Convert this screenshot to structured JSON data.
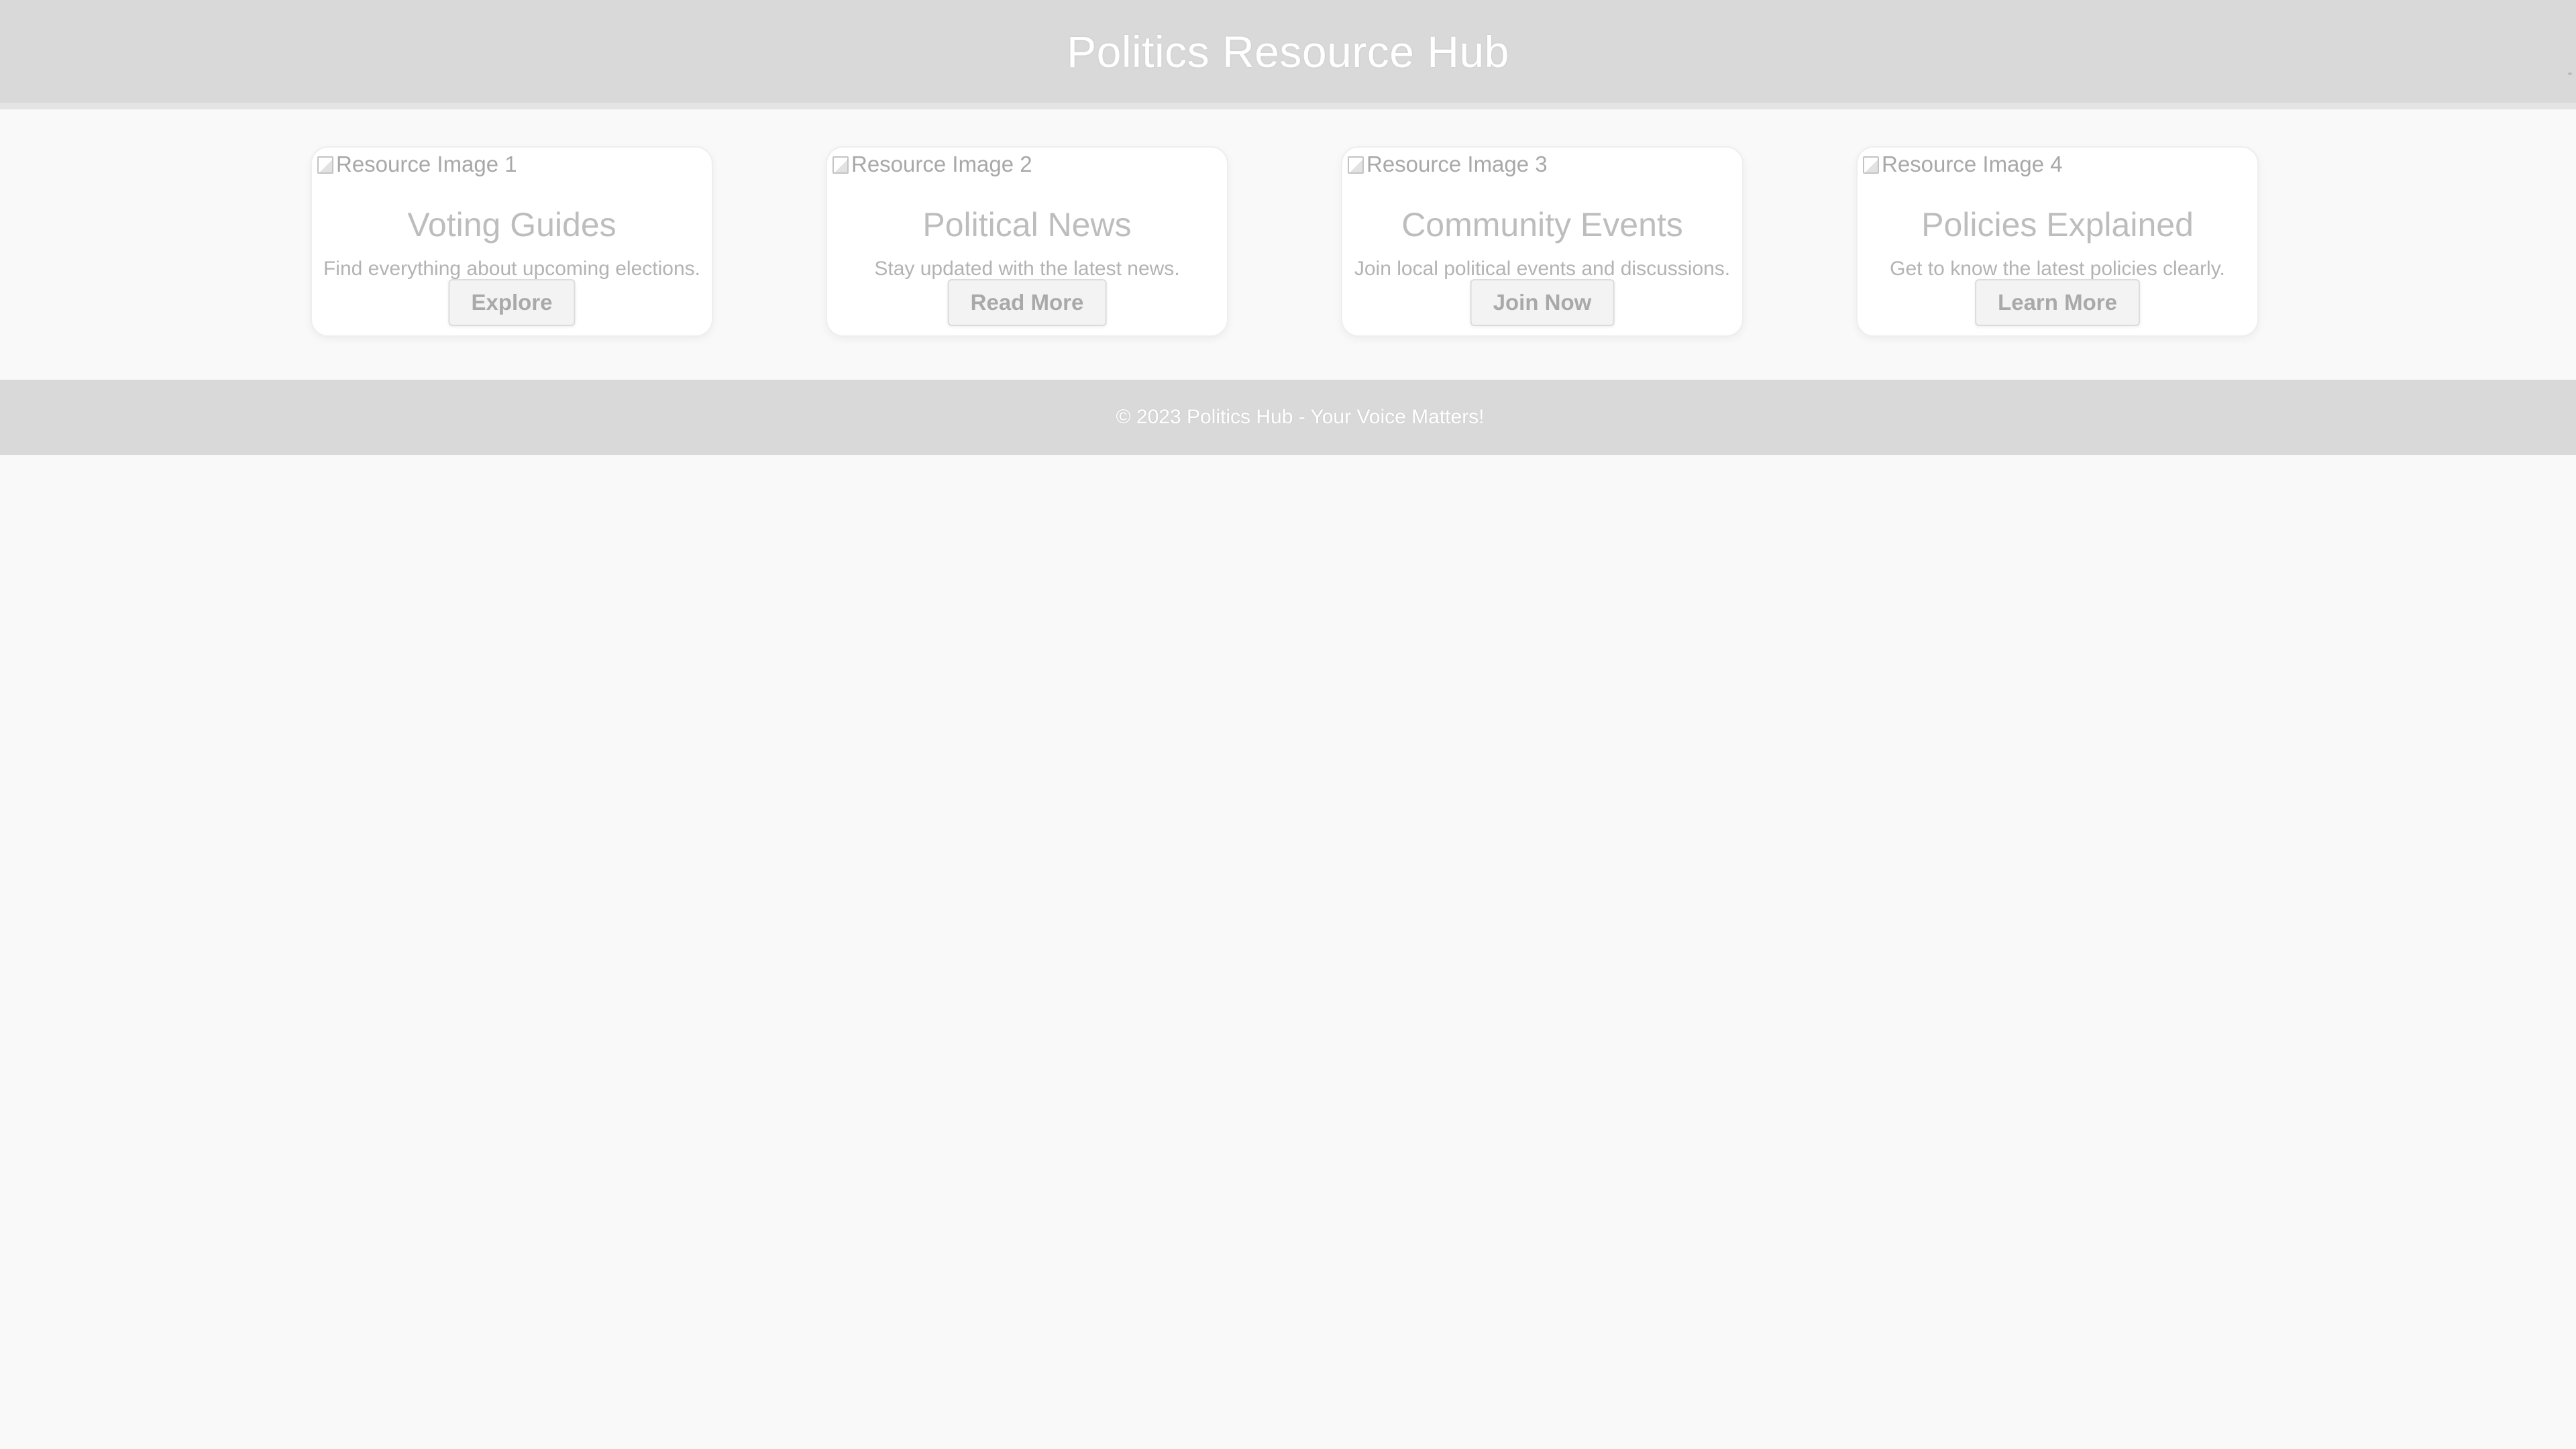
{
  "header": {
    "title": "Politics Resource Hub"
  },
  "cards": [
    {
      "image_alt": "Resource Image 1",
      "title": "Voting Guides",
      "description": "Find everything about upcoming elections.",
      "button_label": "Explore"
    },
    {
      "image_alt": "Resource Image 2",
      "title": "Political News",
      "description": "Stay updated with the latest news.",
      "button_label": "Read More"
    },
    {
      "image_alt": "Resource Image 3",
      "title": "Community Events",
      "description": "Join local political events and discussions.",
      "button_label": "Join Now"
    },
    {
      "image_alt": "Resource Image 4",
      "title": "Policies Explained",
      "description": "Get to know the latest policies clearly.",
      "button_label": "Learn More"
    }
  ],
  "footer": {
    "text": "© 2023 Politics Hub - Your Voice Matters!"
  },
  "colors": {
    "header_bg": "#d9d9d9",
    "page_bg": "#f9f9f9",
    "card_bg": "#ffffff",
    "text_muted": "#b3b3b3"
  }
}
